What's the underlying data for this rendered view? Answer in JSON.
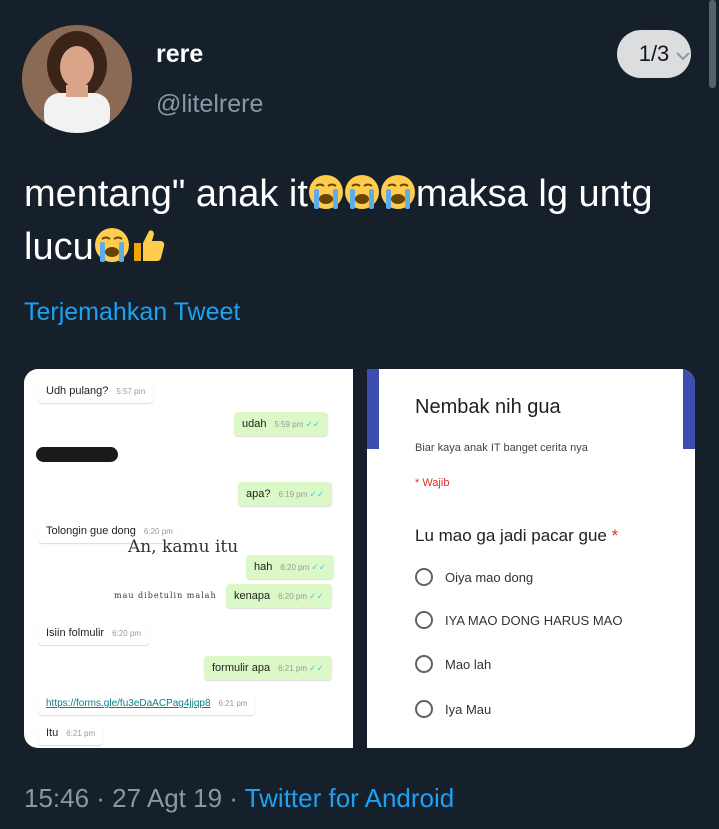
{
  "user": {
    "name": "rere",
    "handle": "@litelrere"
  },
  "counter": "1/3",
  "tweet": {
    "text_a": "mentang\" anak it",
    "text_b": "maksa lg untg lucu"
  },
  "translate_label": "Terjemahkan Tweet",
  "chat": {
    "m1": {
      "text": "Udh pulang?",
      "time": "5:57 pm"
    },
    "m2": {
      "text": "udah",
      "time": "5:59 pm"
    },
    "m3": {
      "text": "apa?",
      "time": "6:19 pm"
    },
    "m4": {
      "text": "Tolongin gue dong",
      "time": "6:20 pm"
    },
    "m5": {
      "text": "hah",
      "time": "6:20 pm"
    },
    "m6": {
      "text": "kenapa",
      "time": "6:20 pm"
    },
    "m7": {
      "text": "Isiin folmulir",
      "time": "6:20 pm"
    },
    "m8": {
      "text": "formulir apa",
      "time": "6:21 pm"
    },
    "m9": {
      "text": "https://forms.gle/fu3eDaACPag4jjqp8",
      "time": "6:21 pm"
    },
    "m10": {
      "text": "Itu",
      "time": "6:21 pm"
    },
    "ticks": "✓✓",
    "handwriting1": "An, kamu itu",
    "handwriting2": "mau dibetulin malah"
  },
  "form": {
    "title": "Nembak nih gua",
    "description": "Biar kaya anak IT banget cerita nya",
    "required_note": "* Wajib",
    "question": "Lu mao ga jadi pacar gue",
    "required_star": "*",
    "options": [
      "Oiya mao dong",
      "IYA MAO DONG HARUS MAO",
      "Mao lah",
      "Iya Mau"
    ],
    "accent": "#3c4fb0"
  },
  "footer": {
    "time_date": "15:46 · 27 Agt 19 · ",
    "app": "Twitter for Android"
  },
  "icons": {
    "crying": "loudly-crying-face-icon",
    "thumbs": "thumbs-up-icon"
  }
}
